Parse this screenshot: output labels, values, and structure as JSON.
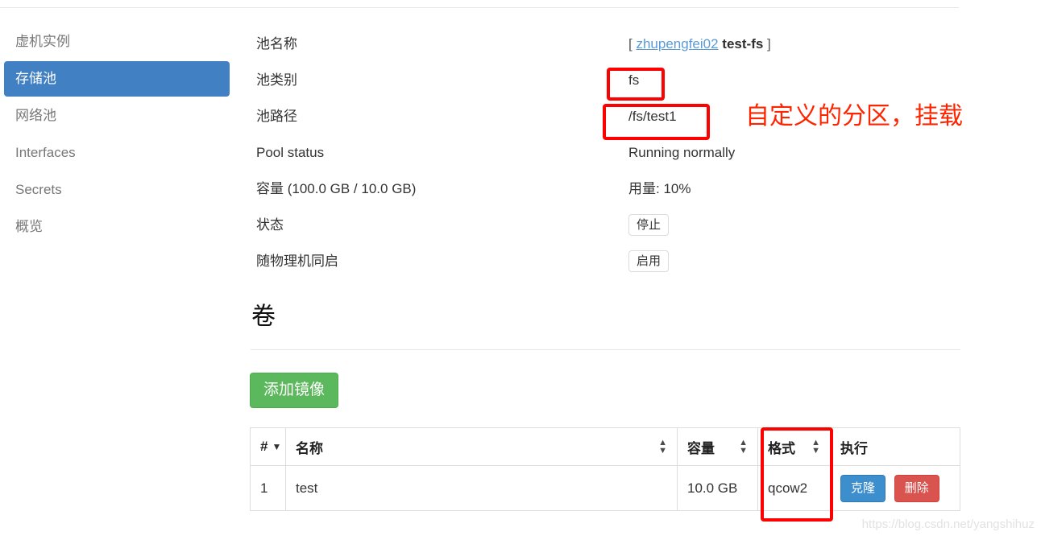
{
  "sidebar": {
    "items": [
      {
        "label": "虚机实例",
        "active": false
      },
      {
        "label": "存储池",
        "active": true
      },
      {
        "label": "网络池",
        "active": false
      },
      {
        "label": "Interfaces",
        "active": false
      },
      {
        "label": "Secrets",
        "active": false
      },
      {
        "label": "概览",
        "active": false
      }
    ]
  },
  "detail": {
    "pool_name_label": "池名称",
    "pool_name_bracket_open": "[",
    "pool_name_owner": "zhupengfei02",
    "pool_name_value": "test-fs",
    "pool_name_bracket_close": "]",
    "pool_type_label": "池类别",
    "pool_type_value": "fs",
    "pool_path_label": "池路径",
    "pool_path_value": "/fs/test1",
    "pool_status_label": "Pool status",
    "pool_status_value": "Running normally",
    "capacity_label": "容量 (100.0 GB / 10.0 GB)",
    "capacity_value": "用量: 10%",
    "state_label": "状态",
    "state_value": "停止",
    "autostart_label": "随物理机同启",
    "autostart_value": "启用"
  },
  "volumes": {
    "title": "卷",
    "add_button": "添加镜像",
    "columns": [
      "#",
      "名称",
      "容量",
      "格式",
      "执行"
    ],
    "rows": [
      {
        "num": "1",
        "name": "test",
        "capacity": "10.0 GB",
        "format": "qcow2",
        "clone_label": "克隆",
        "delete_label": "删除"
      }
    ]
  },
  "annotations": {
    "note_text": "自定义的分区，挂载",
    "color": "#ff0000"
  },
  "watermark": "https://blog.csdn.net/yangshihuz"
}
